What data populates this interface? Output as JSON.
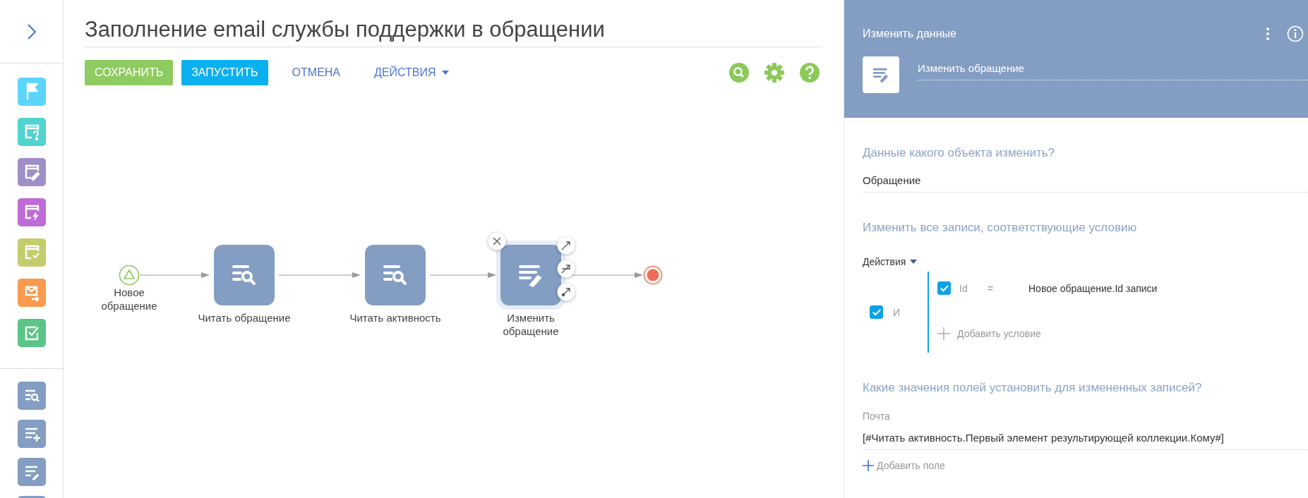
{
  "sidebar": {
    "groups": [
      {
        "items": [
          {
            "kind": "flag",
            "color": "#5bd5fc"
          },
          {
            "kind": "question",
            "color": "#52d3cf"
          },
          {
            "kind": "edit",
            "color": "#a08ec6"
          },
          {
            "kind": "lightning",
            "color": "#bf6bd6"
          },
          {
            "kind": "check",
            "color": "#c6cb6b"
          },
          {
            "kind": "email",
            "color": "#f99a4f"
          },
          {
            "kind": "task",
            "color": "#5bc586"
          }
        ]
      },
      {
        "items": [
          {
            "kind": "read",
            "color": "#839dc3"
          },
          {
            "kind": "add",
            "color": "#839dc3"
          },
          {
            "kind": "modify",
            "color": "#839dc3"
          },
          {
            "kind": "blank",
            "color": "#839dc3"
          }
        ]
      }
    ]
  },
  "title": "Заполнение email службы поддержки в обращении",
  "toolbar": {
    "buttons": [
      {
        "label": "СОХРАНИТЬ",
        "kind": "save"
      },
      {
        "label": "ЗАПУСТИТЬ",
        "kind": "run"
      },
      {
        "label": "ОТМЕНА",
        "kind": "link"
      },
      {
        "label": "ДЕЙСТВИЯ",
        "kind": "menu"
      }
    ]
  },
  "diagram": {
    "nodes": [
      {
        "kind": "start",
        "label": "Новое\nобращение",
        "selected": false
      },
      {
        "kind": "read",
        "label": "Читать обращение",
        "selected": false
      },
      {
        "kind": "read",
        "label": "Читать активность",
        "selected": false
      },
      {
        "kind": "modify",
        "label": "Изменить\nобращение",
        "selected": true
      },
      {
        "kind": "end",
        "selected": false
      }
    ]
  },
  "panel": {
    "element_type": "Изменить данные",
    "name": "Изменить обращение",
    "object_question": "Данные какого объекта изменить?",
    "object": "Обращение",
    "filter_title": "Изменить все записи, соответствующие условию",
    "filter": {
      "actions_label": "Действия",
      "operator": "И",
      "checked": true,
      "conditions": [
        {
          "checked": true,
          "field": "Id",
          "comparison": "=",
          "value": "Новое обращение.Id записи"
        }
      ],
      "add_label": "Добавить условие"
    },
    "values_title": "Какие значения полей установить для измененных записей?",
    "fields": [
      {
        "label": "Почта",
        "value": "[#Читать активность.Первый элемент результирующей коллекции.Кому#]"
      }
    ],
    "add_field_label": "Добавить поле"
  }
}
